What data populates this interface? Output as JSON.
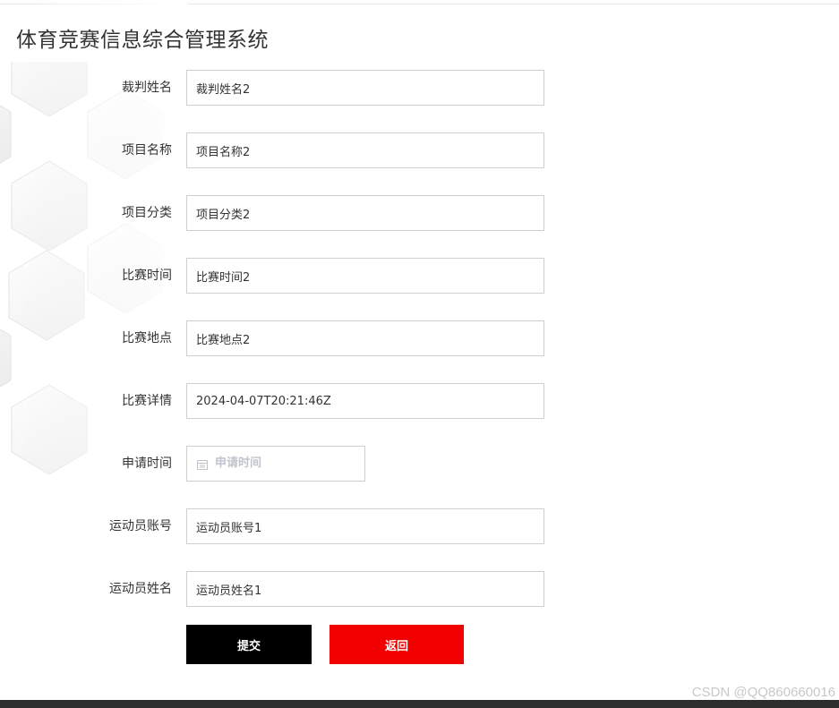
{
  "header": {
    "title": "体育竞赛信息综合管理系统"
  },
  "form": {
    "fields": [
      {
        "label": "裁判姓名",
        "value": "裁判姓名2"
      },
      {
        "label": "项目名称",
        "value": "项目名称2"
      },
      {
        "label": "项目分类",
        "value": "项目分类2"
      },
      {
        "label": "比赛时间",
        "value": "比赛时间2"
      },
      {
        "label": "比赛地点",
        "value": "比赛地点2"
      },
      {
        "label": "比赛详情",
        "value": "2024-04-07T20:21:46Z"
      },
      {
        "label": "申请时间",
        "value": "",
        "placeholder": "申请时间",
        "icon": "calendar-icon"
      },
      {
        "label": "运动员账号",
        "value": "运动员账号1"
      },
      {
        "label": "运动员姓名",
        "value": "运动员姓名1"
      }
    ]
  },
  "actions": {
    "submit_label": "提交",
    "back_label": "返回"
  },
  "colors": {
    "submit_bg": "#000000",
    "back_bg": "#f20000",
    "footer": "#2d2d2d"
  },
  "watermark": "CSDN @QQ860660016"
}
